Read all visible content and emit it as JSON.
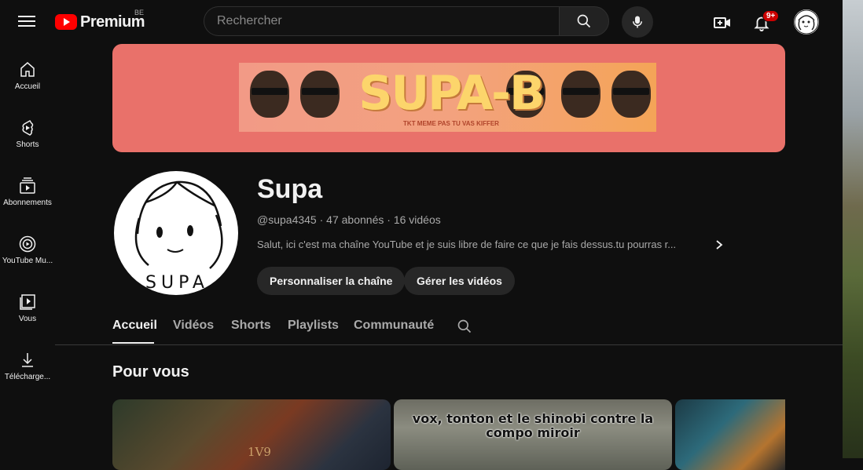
{
  "header": {
    "logo_text": "Premium",
    "country_code": "BE",
    "search_placeholder": "Rechercher",
    "notification_count": "9+"
  },
  "sidebar": {
    "items": [
      {
        "label": "Accueil",
        "icon": "home-icon"
      },
      {
        "label": "Shorts",
        "icon": "shorts-icon"
      },
      {
        "label": "Abonnements",
        "icon": "subscriptions-icon"
      },
      {
        "label": "YouTube Mu...",
        "icon": "youtube-music-icon"
      },
      {
        "label": "Vous",
        "icon": "library-icon"
      },
      {
        "label": "Télécharge...",
        "icon": "download-icon"
      }
    ]
  },
  "banner": {
    "title": "SUPA-B",
    "subtitle": "TKT MEME PAS TU VAS KIFFER",
    "background_color": "#e9716a"
  },
  "channel": {
    "name": "Supa",
    "handle": "@supa4345",
    "subscribers": "47 abonnés",
    "videos": "16 vidéos",
    "separator": "·",
    "description": "Salut, ici c'est ma chaîne YouTube et je suis libre de faire ce que je fais dessus.tu pourras r...",
    "avatar_text": "SUPA"
  },
  "actions": {
    "customize": "Personnaliser la chaîne",
    "manage": "Gérer les vidéos"
  },
  "tabs": [
    {
      "label": "Accueil",
      "active": true
    },
    {
      "label": "Vidéos",
      "active": false
    },
    {
      "label": "Shorts",
      "active": false
    },
    {
      "label": "Playlists",
      "active": false
    },
    {
      "label": "Communauté",
      "active": false
    }
  ],
  "section": {
    "title": "Pour vous"
  },
  "videos": [
    {
      "thumb_text": "1V9"
    },
    {
      "thumb_text": "vox, tonton et le shinobi contre la compo miroir"
    },
    {
      "thumb_text": ""
    }
  ]
}
